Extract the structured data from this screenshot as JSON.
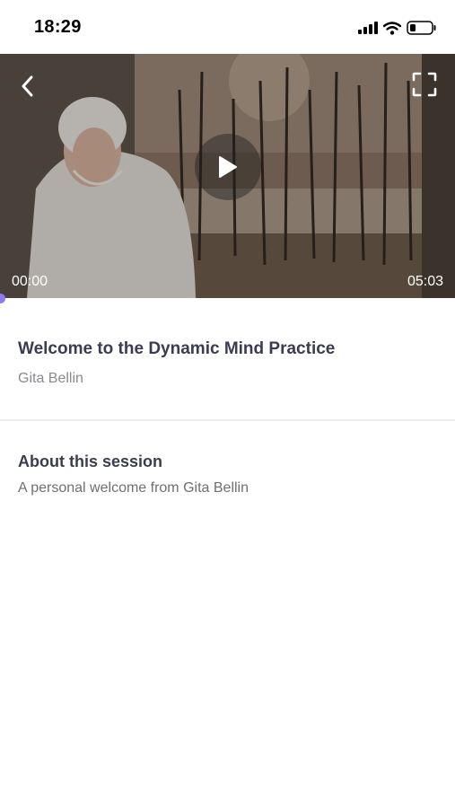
{
  "status_bar": {
    "time": "18:29",
    "icons": [
      "signal-icon",
      "wifi-icon",
      "battery-icon"
    ]
  },
  "video": {
    "current_time": "00:00",
    "duration": "05:03",
    "progress_fraction": 0.0,
    "controls": [
      "back-icon",
      "fullscreen-icon",
      "play-icon"
    ],
    "accent_color": "#8c7cf0"
  },
  "session": {
    "title": "Welcome to the Dynamic Mind Practice",
    "author": "Gita Bellin"
  },
  "about": {
    "heading": "About this session",
    "description": "A personal welcome from Gita Bellin"
  }
}
